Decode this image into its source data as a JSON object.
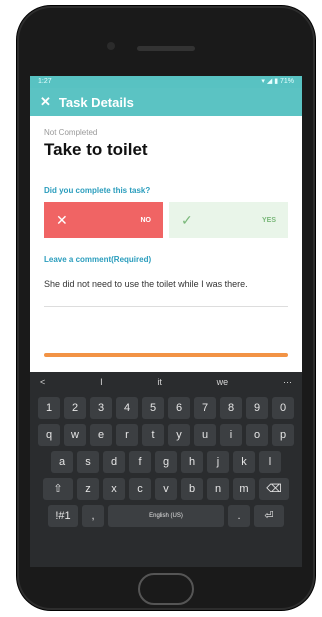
{
  "status_bar": {
    "time": "1:27",
    "right": "▾ ◢ ▮ 71%"
  },
  "app_bar": {
    "title": "Task Details",
    "close_glyph": "✕"
  },
  "task": {
    "status": "Not Completed",
    "title": "Take to toilet"
  },
  "question": {
    "label": "Did you complete this task?"
  },
  "answers": {
    "no": {
      "label": "NO",
      "icon": "✕"
    },
    "yes": {
      "label": "YES",
      "icon": "✓"
    }
  },
  "comment": {
    "label": "Leave a comment(Required)",
    "value": "She did not need to use the toilet while I was there."
  },
  "keyboard": {
    "suggestions": [
      "<",
      "I",
      "it",
      "we",
      "⋯"
    ],
    "row_numbers": [
      "1",
      "2",
      "3",
      "4",
      "5",
      "6",
      "7",
      "8",
      "9",
      "0"
    ],
    "row_q": [
      "q",
      "w",
      "e",
      "r",
      "t",
      "y",
      "u",
      "i",
      "o",
      "p"
    ],
    "row_a": [
      "a",
      "s",
      "d",
      "f",
      "g",
      "h",
      "j",
      "k",
      "l"
    ],
    "row_z": [
      "z",
      "x",
      "c",
      "v",
      "b",
      "n",
      "m"
    ],
    "shift_glyph": "⇧",
    "backspace_glyph": "⌫",
    "symbols_label": "!#1",
    "comma": ",",
    "space_label": "English (US)",
    "period": ".",
    "enter_glyph": "⏎"
  }
}
